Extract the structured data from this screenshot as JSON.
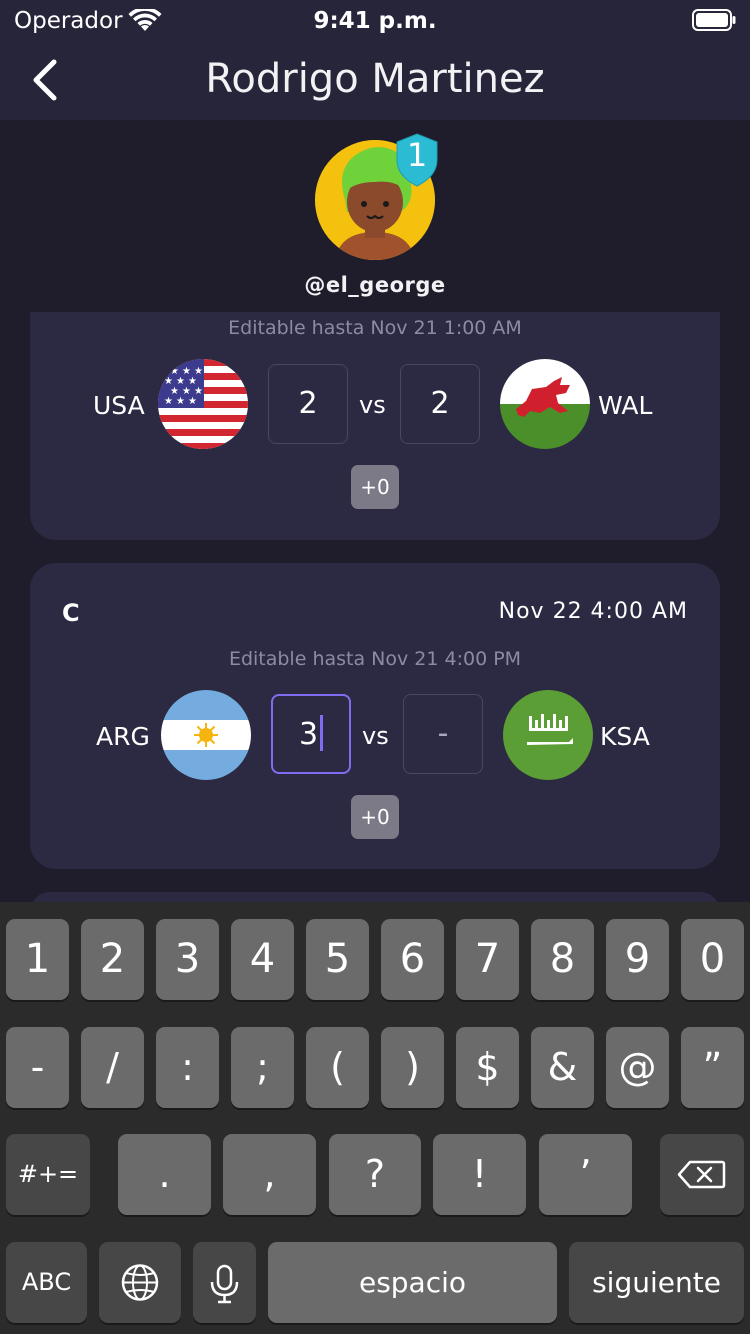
{
  "status_bar": {
    "carrier": "Operador",
    "time": "9:41 p.m."
  },
  "nav": {
    "title": "Rodrigo Martinez"
  },
  "profile": {
    "username": "@el_george",
    "rank": "1"
  },
  "matches": [
    {
      "editable_until": "Editable hasta Nov 21 1:00 AM",
      "home": {
        "code": "USA",
        "score": "2"
      },
      "vs": "vs",
      "away": {
        "code": "WAL",
        "score": "2"
      },
      "points": "+0"
    },
    {
      "group": "C",
      "date": "Nov 22 4:00 AM",
      "editable_until": "Editable hasta Nov 21 4:00 PM",
      "home": {
        "code": "ARG",
        "score": "3"
      },
      "vs": "vs",
      "away": {
        "code": "KSA",
        "score": "-"
      },
      "points": "+0"
    }
  ],
  "keyboard": {
    "row1": [
      "1",
      "2",
      "3",
      "4",
      "5",
      "6",
      "7",
      "8",
      "9",
      "0"
    ],
    "row2": [
      "-",
      "/",
      ":",
      ";",
      "(",
      ")",
      "$",
      "&",
      "@",
      "”"
    ],
    "row3": [
      "#+=",
      ".",
      ",",
      "?",
      "!",
      "’"
    ],
    "abc": "ABC",
    "space": "espacio",
    "next": "siguiente"
  },
  "colors": {
    "accent": "#7e6df0",
    "card": "#2c2a42",
    "background": "#1f1d2b",
    "badge": "#2bbcd4"
  }
}
